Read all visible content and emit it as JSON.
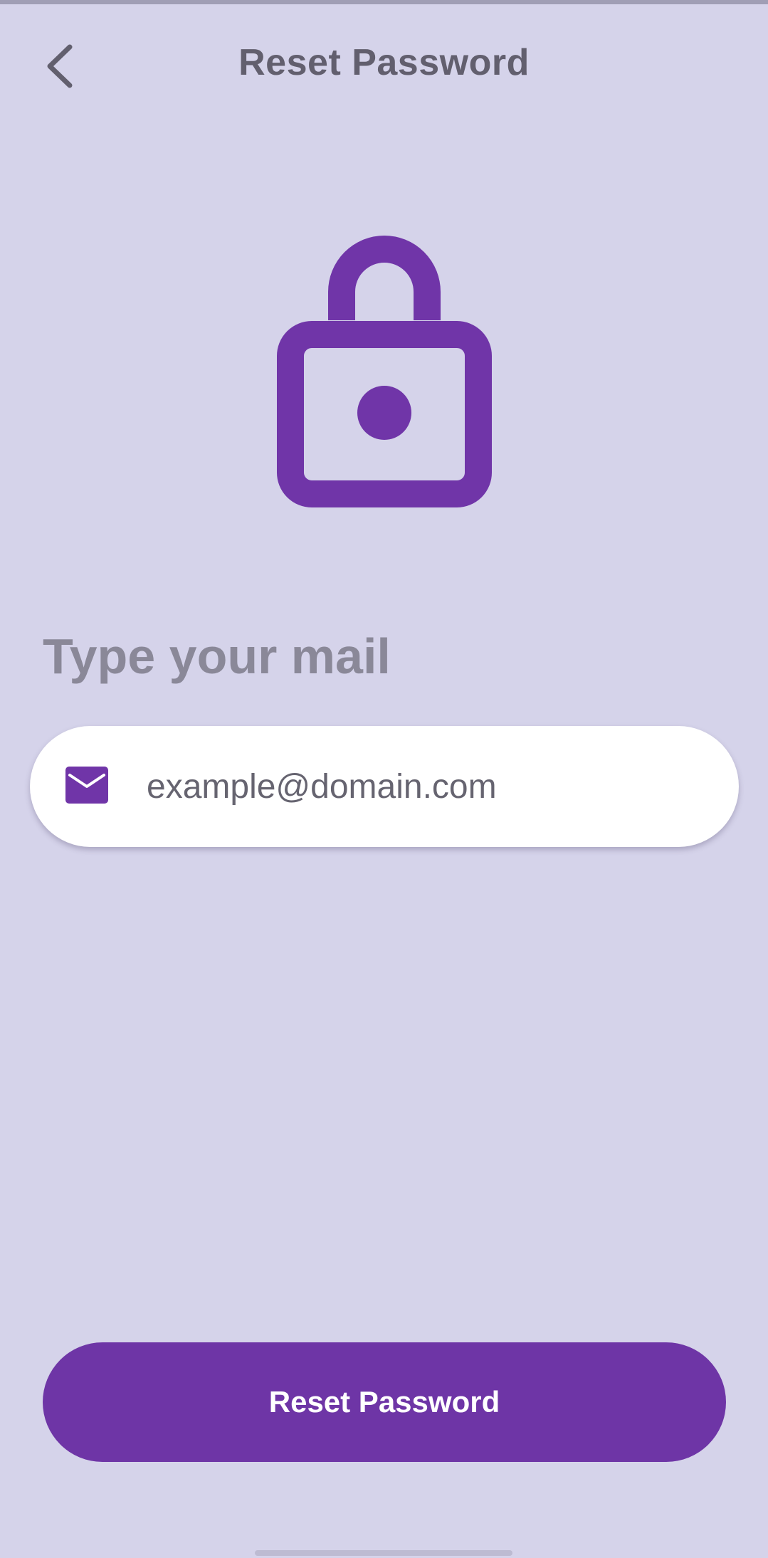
{
  "header": {
    "title": "Reset Password",
    "back_icon": "chevron-left-icon"
  },
  "hero": {
    "icon": "lock-icon",
    "color": "#7035a8"
  },
  "form": {
    "label": "Type your mail",
    "email_field": {
      "icon": "mail-icon",
      "placeholder": "example@domain.com",
      "value": ""
    }
  },
  "actions": {
    "reset_label": "Reset Password"
  },
  "colors": {
    "background": "#d5d3ea",
    "accent": "#6e35a6",
    "title_text": "#625f6e",
    "label_text": "#8a8898"
  }
}
